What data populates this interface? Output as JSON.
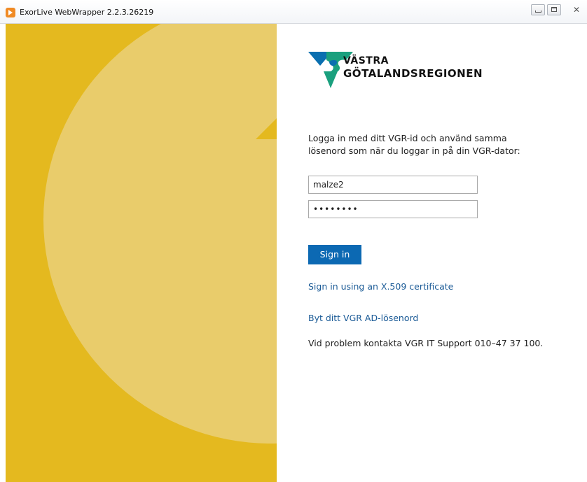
{
  "window": {
    "title": "ExorLive WebWrapper 2.2.3.26219",
    "app_icon": "exorlive-app-icon",
    "controls": {
      "minimize": "minimize-icon",
      "maximize": "maximize-icon",
      "close_glyph": "✕"
    }
  },
  "branding": {
    "logo_line1": "VÄSTRA",
    "logo_line2": "GÖTALANDSREGIONEN",
    "colors": {
      "blue": "#0a6fb0",
      "green": "#1aa07e",
      "gold": "#e4b91f",
      "light_gold": "#e9cc6b"
    }
  },
  "login": {
    "intro": "Logga in med ditt VGR-id och använd samma lösenord som när du loggar in på din VGR-dator:",
    "username_value": "malze2",
    "password_value": "••••••••",
    "signin_label": "Sign in",
    "cert_link": "Sign in using an X.509 certificate",
    "change_password_link": "Byt ditt VGR AD-lösenord",
    "support_text": "Vid problem kontakta VGR IT Support 010–47 37 100."
  }
}
